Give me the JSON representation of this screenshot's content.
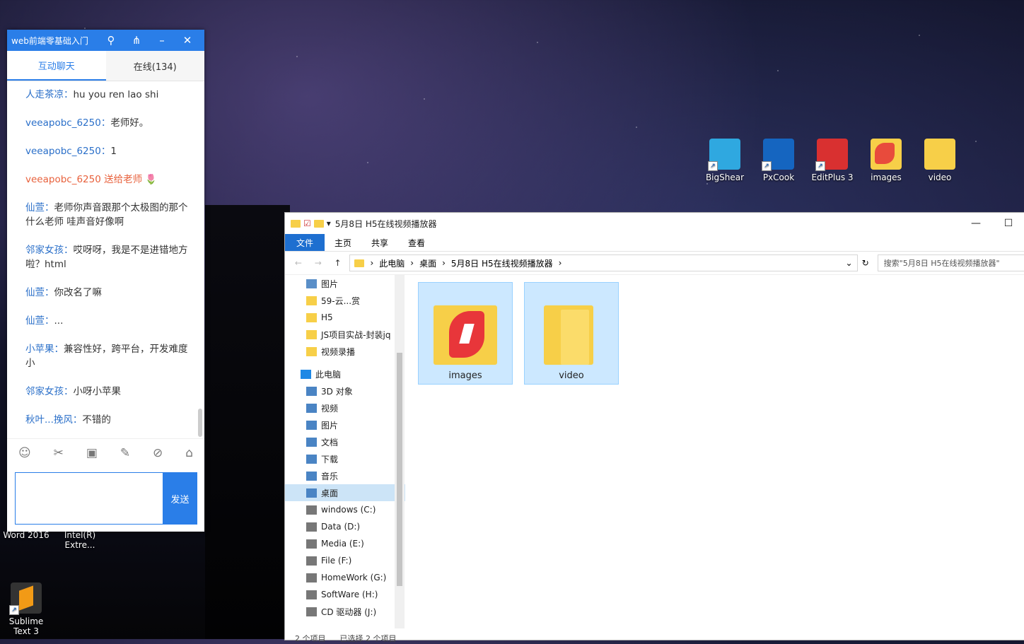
{
  "desktop": {
    "right_icons": [
      {
        "label": "BigShear",
        "color": "#2fa8e0"
      },
      {
        "label": "PxCook",
        "color": "#1565c0"
      },
      {
        "label": "EditPlus 3",
        "color": "#d93030"
      },
      {
        "label": "images",
        "color": "#e84b3c"
      },
      {
        "label": "video",
        "color": "#f7cf48"
      }
    ],
    "left_icons": [
      {
        "label": "Word 2016"
      },
      {
        "label": "Intel(R) Extre..."
      },
      {
        "label": "Sublime Text 3"
      }
    ]
  },
  "chat": {
    "title": "web前端零基础入门",
    "tabs": {
      "chat": "互动聊天",
      "online": "在线(134)"
    },
    "messages": [
      {
        "user": "人走茶凉",
        "text": "hu you ren lao shi"
      },
      {
        "user": "veeapobc_6250",
        "text": "老师好。"
      },
      {
        "user": "veeapobc_6250",
        "text": "1"
      },
      {
        "user": "",
        "text": "veeapobc_6250 送给老师 🌷",
        "gift": true
      },
      {
        "user": "仙萱",
        "text": "老师你声音跟那个太极图的那个什么老师 哇声音好像啊"
      },
      {
        "user": "邻家女孩",
        "text": "哎呀呀，我是不是进错地方啦？html"
      },
      {
        "user": "仙萱",
        "text": "你改名了嘛"
      },
      {
        "user": "仙萱",
        "text": "..."
      },
      {
        "user": "小苹果",
        "text": "兼容性好，跨平台，开发难度小"
      },
      {
        "user": "邻家女孩",
        "text": "小呀小苹果"
      },
      {
        "user": "秋叶...挽风",
        "text": "不错的"
      }
    ],
    "send_label": "发送"
  },
  "explorer": {
    "title": "5月8日  H5在线视频播放器",
    "ribbon": [
      "文件",
      "主页",
      "共享",
      "查看"
    ],
    "breadcrumb": [
      "此电脑",
      "桌面",
      "5月8日  H5在线视频播放器"
    ],
    "search_placeholder": "搜索\"5月8日  H5在线视频播放器\"",
    "nav_quick": [
      "图片",
      "59-云...赏",
      "H5",
      "JS项目实战-封装jq",
      "视频录播"
    ],
    "nav_pc_root": "此电脑",
    "nav_pc": [
      "3D 对象",
      "视频",
      "图片",
      "文档",
      "下载",
      "音乐",
      "桌面",
      "windows (C:)",
      "Data (D:)",
      "Media (E:)",
      "File (F:)",
      "HomeWork (G:)",
      "SoftWare (H:)",
      "CD 驱动器 (J:)"
    ],
    "files": [
      {
        "name": "images"
      },
      {
        "name": "video"
      }
    ],
    "status": [
      "2 个项目",
      "已选择 2 个项目"
    ]
  }
}
